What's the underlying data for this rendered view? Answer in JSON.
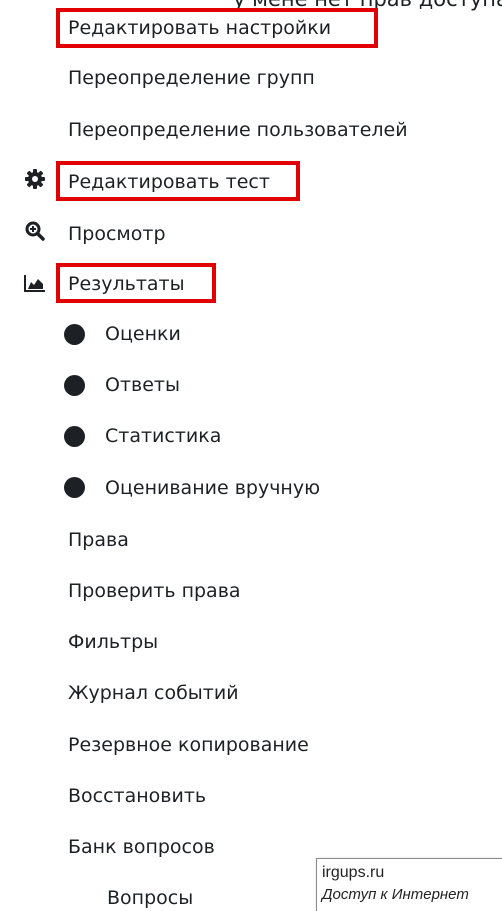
{
  "top_cutoff_text": "у мене нет прав доступа",
  "menu": {
    "edit_settings": "Редактировать настройки",
    "group_overrides": "Переопределение групп",
    "user_overrides": "Переопределение пользователей",
    "edit_quiz": "Редактировать тест",
    "preview": "Просмотр",
    "results": "Результаты",
    "results_items": [
      "Оценки",
      "Ответы",
      "Статистика",
      "Оценивание вручную"
    ],
    "permissions": "Права",
    "check_permissions": "Проверить права",
    "filters": "Фильтры",
    "logs": "Журнал событий",
    "backup": "Резервное копирование",
    "restore": "Восстановить",
    "question_bank": "Банк вопросов",
    "questions": "Вопросы"
  },
  "tooltip": {
    "host": "irgups.ru",
    "status": "Доступ к Интернет"
  },
  "icons": {
    "edit_quiz": "gear-icon",
    "preview": "magnifier-plus-icon",
    "results": "area-chart-icon"
  },
  "colors": {
    "highlight": "#e00000",
    "text": "#1d2125"
  }
}
